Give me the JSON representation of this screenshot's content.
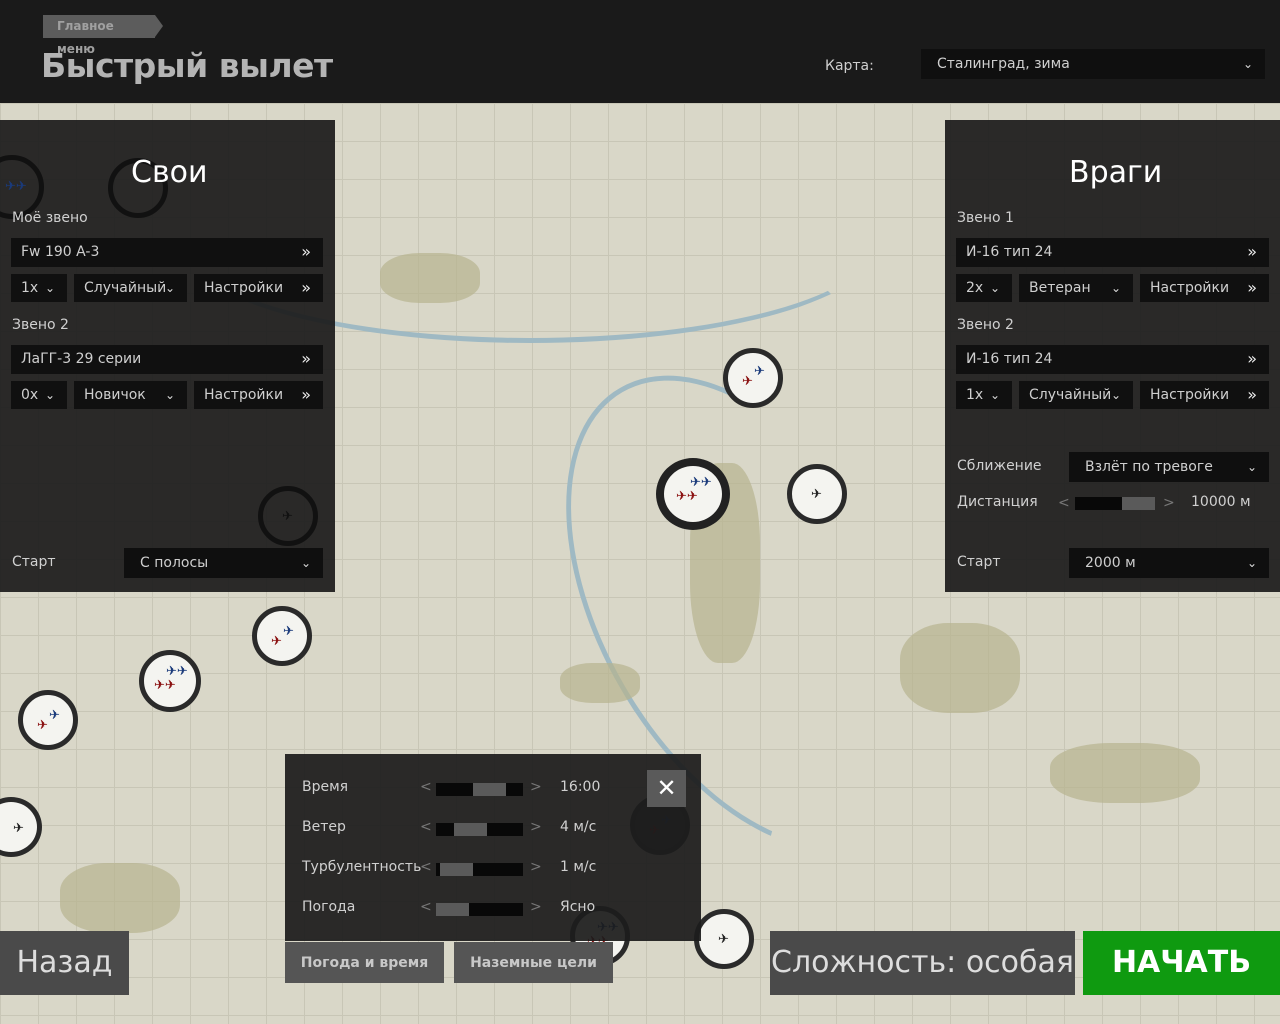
{
  "header": {
    "breadcrumb": "Главное меню",
    "title": "Быстрый вылет",
    "map_label": "Карта:",
    "map_value": "Сталинград, зима"
  },
  "friends": {
    "title": "Свои",
    "flight1": {
      "label": "Моё звено",
      "aircraft": "Fw 190 A-3",
      "count": "1x",
      "skill": "Случайный",
      "settings": "Настройки"
    },
    "flight2": {
      "label": "Звено 2",
      "aircraft": "ЛаГГ-3 29 серии",
      "count": "0x",
      "skill": "Новичок",
      "settings": "Настройки"
    },
    "start_label": "Старт",
    "start_value": "С полосы"
  },
  "enemies": {
    "title": "Враги",
    "flight1": {
      "label": "Звено 1",
      "aircraft": "И-16 тип 24",
      "count": "2x",
      "skill": "Ветеран",
      "settings": "Настройки"
    },
    "flight2": {
      "label": "Звено 2",
      "aircraft": "И-16 тип 24",
      "count": "1x",
      "skill": "Случайный",
      "settings": "Настройки"
    },
    "approach_label": "Сближение",
    "approach_value": "Взлёт по тревоге",
    "distance_label": "Дистанция",
    "distance_value": "10000 м",
    "distance_level": 1.0,
    "start_label": "Старт",
    "start_value": "2000 м"
  },
  "weather": {
    "rows": [
      {
        "label": "Время",
        "value": "16:00",
        "level": 0.68
      },
      {
        "label": "Ветер",
        "value": "4 м/с",
        "level": 0.33
      },
      {
        "label": "Турбулентность",
        "value": "1 м/с",
        "level": 0.07
      },
      {
        "label": "Погода",
        "value": "Ясно",
        "level": 0.0
      }
    ],
    "close": "✕"
  },
  "tabs": {
    "weather": "Погода и время",
    "ground": "Наземные цели"
  },
  "footer": {
    "back": "Назад",
    "difficulty": "Сложность: особая",
    "start": "НАЧАТЬ"
  },
  "colors": {
    "start_button": "#0f9a10",
    "friendly": "#1a3a7a",
    "enemy": "#8a1010"
  }
}
